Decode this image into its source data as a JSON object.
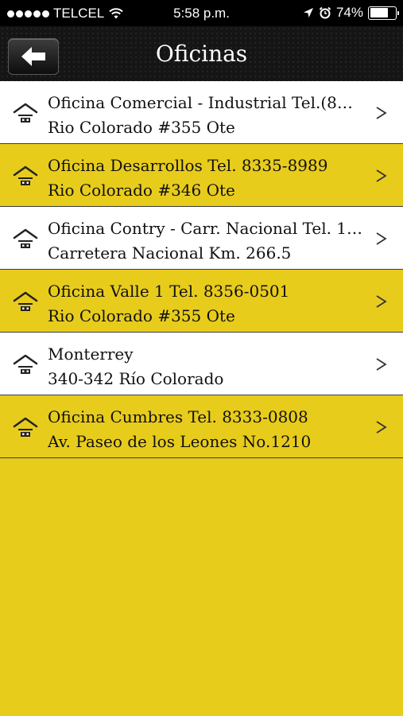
{
  "status_bar": {
    "carrier": "TELCEL",
    "time": "5:58 p.m.",
    "battery": "74%",
    "battery_level": 0.74,
    "icons": [
      "signal-dots-icon",
      "wifi-icon",
      "location-arrow-icon",
      "alarm-clock-icon",
      "battery-icon"
    ]
  },
  "nav": {
    "title": "Oficinas",
    "back_icon": "back-arrow-icon"
  },
  "offices": [
    {
      "title": "Oficina Comercial - Industrial Tel.(8…",
      "address": "Rio Colorado #355 Ote",
      "style": "white"
    },
    {
      "title": "Oficina Desarrollos Tel. 8335-8989",
      "address": "Rio Colorado #346 Ote",
      "style": "yellow"
    },
    {
      "title": "Oficina Contry - Carr. Nacional Tel. 1…",
      "address": "Carretera Nacional Km. 266.5",
      "style": "white"
    },
    {
      "title": "Oficina Valle 1 Tel. 8356-0501",
      "address": "Rio Colorado #355 Ote",
      "style": "yellow"
    },
    {
      "title": "Monterrey",
      "address": "340-342 Río Colorado",
      "style": "white"
    },
    {
      "title": "Oficina Cumbres Tel. 8333-0808",
      "address": "Av. Paseo de los Leones No.1210",
      "style": "yellow"
    }
  ],
  "colors": {
    "accent_yellow": "#e8cc1c",
    "nav_background": "#151515",
    "row_white": "#ffffff"
  }
}
